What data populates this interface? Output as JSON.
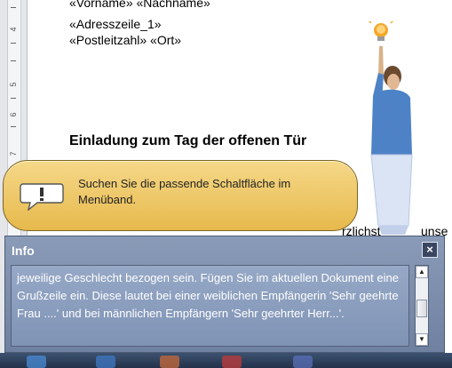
{
  "document": {
    "ruler_numbers": [
      "4",
      "5",
      "6",
      "7"
    ],
    "lines": [
      "«Vorname» «Nachname»",
      "«Adresszeile_1»",
      "«Postleitzahl» «Ort»"
    ],
    "heading": "Einladung zum Tag der offenen Tür",
    "fragment_1": "rzlichst",
    "fragment_2": "unse"
  },
  "callout": {
    "text": "Suchen Sie die passende Schaltfläche im Menüband.",
    "icon": "speech-exclamation-icon"
  },
  "info_panel": {
    "title": "Info",
    "close_label": "×",
    "body": "jeweilige Geschlecht bezogen sein. Fügen Sie im aktuellen Dokument eine Grußzeile ein. Diese lautet bei einer weiblichen Empfängerin 'Sehr geehrte Frau ....' und bei männlichen Empfängern 'Sehr geehrter Herr...'.",
    "scroll_position": 0.55
  },
  "assistant": {
    "icon": "lightbulb-icon"
  },
  "colors": {
    "callout_bg": "#f0cc6e",
    "panel_bg": "#7f93b5",
    "taskbar": "#2c3d58"
  }
}
